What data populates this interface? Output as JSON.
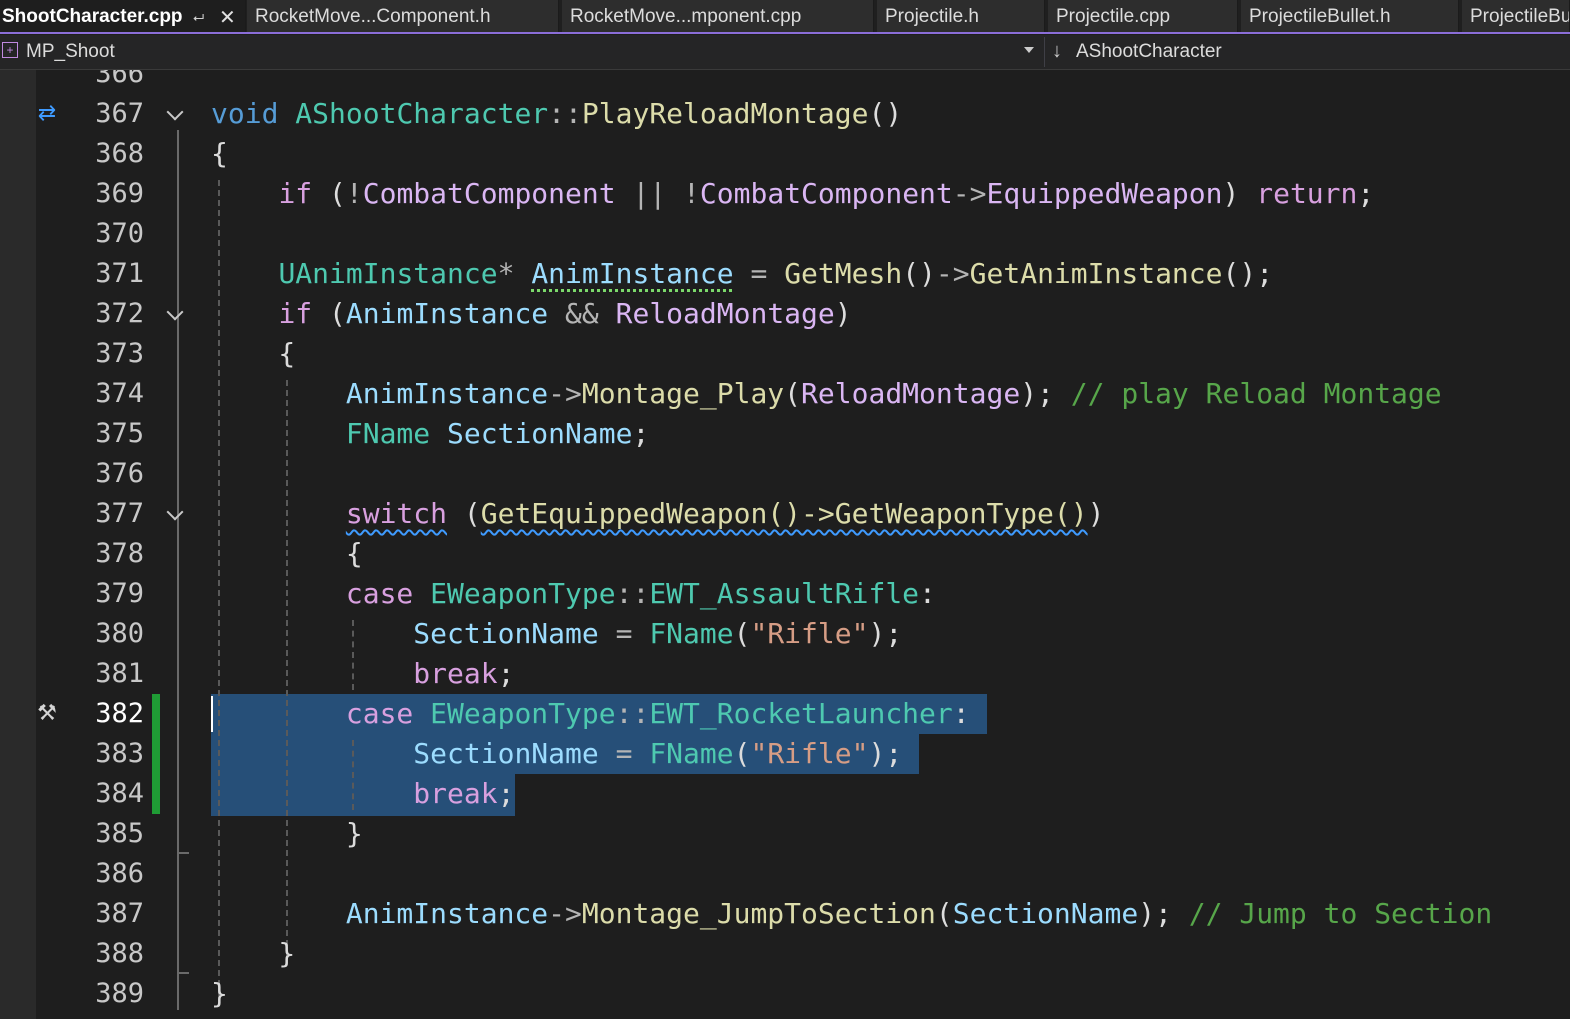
{
  "tabs": [
    {
      "label": "ShootCharacter.cpp",
      "active": true
    },
    {
      "label": "RocketMove...Component.h"
    },
    {
      "label": "RocketMove...mponent.cpp"
    },
    {
      "label": "Projectile.h"
    },
    {
      "label": "Projectile.cpp"
    },
    {
      "label": "ProjectileBullet.h"
    },
    {
      "label": "ProjectileBu"
    }
  ],
  "nav": {
    "project": "MP_Shoot",
    "scope": "AShootCharacter"
  },
  "editor": {
    "partial_line": "366",
    "lines": [
      {
        "n": "367",
        "tokens": [
          [
            "kw",
            "void"
          ],
          [
            "p",
            " "
          ],
          [
            "type",
            "AShootCharacter"
          ],
          [
            "op",
            "::"
          ],
          [
            "fn",
            "PlayReloadMontage"
          ],
          [
            "p",
            "()"
          ]
        ]
      },
      {
        "n": "368",
        "tokens": [
          [
            "p",
            "{"
          ]
        ]
      },
      {
        "n": "369",
        "tokens": [
          [
            "p",
            "    "
          ],
          [
            "ctl",
            "if"
          ],
          [
            "p",
            " ("
          ],
          [
            "op",
            "!"
          ],
          [
            "mem",
            "CombatComponent"
          ],
          [
            "p",
            " "
          ],
          [
            "op",
            "||"
          ],
          [
            "p",
            " "
          ],
          [
            "op",
            "!"
          ],
          [
            "mem",
            "CombatComponent"
          ],
          [
            "op",
            "->"
          ],
          [
            "mem",
            "EquippedWeapon"
          ],
          [
            "p",
            ") "
          ],
          [
            "ctl",
            "return"
          ],
          [
            "p",
            ";"
          ]
        ]
      },
      {
        "n": "370",
        "tokens": []
      },
      {
        "n": "371",
        "tokens": [
          [
            "p",
            "    "
          ],
          [
            "type",
            "UAnimInstance"
          ],
          [
            "op",
            "*"
          ],
          [
            "p",
            " "
          ],
          [
            "var_dots",
            "AnimInstance"
          ],
          [
            "p",
            " "
          ],
          [
            "op",
            "="
          ],
          [
            "p",
            " "
          ],
          [
            "fn",
            "GetMesh"
          ],
          [
            "p",
            "()"
          ],
          [
            "op",
            "->"
          ],
          [
            "fn",
            "GetAnimInstance"
          ],
          [
            "p",
            "();"
          ]
        ]
      },
      {
        "n": "372",
        "tokens": [
          [
            "p",
            "    "
          ],
          [
            "ctl",
            "if"
          ],
          [
            "p",
            " ("
          ],
          [
            "var",
            "AnimInstance"
          ],
          [
            "p",
            " "
          ],
          [
            "op",
            "&&"
          ],
          [
            "p",
            " "
          ],
          [
            "mem",
            "ReloadMontage"
          ],
          [
            "p",
            ")"
          ]
        ]
      },
      {
        "n": "373",
        "tokens": [
          [
            "p",
            "    {"
          ]
        ]
      },
      {
        "n": "374",
        "tokens": [
          [
            "p",
            "        "
          ],
          [
            "var",
            "AnimInstance"
          ],
          [
            "op",
            "->"
          ],
          [
            "fn",
            "Montage_Play"
          ],
          [
            "p",
            "("
          ],
          [
            "mem",
            "ReloadMontage"
          ],
          [
            "p",
            "); "
          ],
          [
            "com",
            "// play Reload Montage"
          ]
        ]
      },
      {
        "n": "375",
        "tokens": [
          [
            "p",
            "        "
          ],
          [
            "type",
            "FName"
          ],
          [
            "p",
            " "
          ],
          [
            "var",
            "SectionName"
          ],
          [
            "p",
            ";"
          ]
        ]
      },
      {
        "n": "376",
        "tokens": []
      },
      {
        "n": "377",
        "tokens": [
          [
            "p",
            "        "
          ],
          [
            "ctl_squig",
            "switch"
          ],
          [
            "p",
            " ("
          ],
          [
            "fn_squig",
            "GetEquippedWeapon()->GetWeaponType()"
          ],
          [
            "p",
            ")"
          ]
        ]
      },
      {
        "n": "378",
        "tokens": [
          [
            "p",
            "        {"
          ]
        ]
      },
      {
        "n": "379",
        "tokens": [
          [
            "p",
            "        "
          ],
          [
            "ctl",
            "case"
          ],
          [
            "p",
            " "
          ],
          [
            "type",
            "EWeaponType"
          ],
          [
            "op",
            "::"
          ],
          [
            "type",
            "EWT_AssaultRifle"
          ],
          [
            "p",
            ":"
          ]
        ]
      },
      {
        "n": "380",
        "tokens": [
          [
            "p",
            "            "
          ],
          [
            "var",
            "SectionName"
          ],
          [
            "p",
            " "
          ],
          [
            "op",
            "="
          ],
          [
            "p",
            " "
          ],
          [
            "type",
            "FName"
          ],
          [
            "p",
            "("
          ],
          [
            "str",
            "\"Rifle\""
          ],
          [
            "p",
            ");"
          ]
        ]
      },
      {
        "n": "381",
        "tokens": [
          [
            "p",
            "            "
          ],
          [
            "ctl",
            "break"
          ],
          [
            "p",
            ";"
          ]
        ]
      },
      {
        "n": "382",
        "tokens": [
          [
            "p",
            "        "
          ],
          [
            "ctl",
            "case"
          ],
          [
            "p",
            " "
          ],
          [
            "type",
            "EWeaponType"
          ],
          [
            "op",
            "::"
          ],
          [
            "type",
            "EWT_RocketLauncher"
          ],
          [
            "p",
            ":"
          ]
        ]
      },
      {
        "n": "383",
        "tokens": [
          [
            "p",
            "            "
          ],
          [
            "var",
            "SectionName"
          ],
          [
            "p",
            " "
          ],
          [
            "op",
            "="
          ],
          [
            "p",
            " "
          ],
          [
            "type",
            "FName"
          ],
          [
            "p",
            "("
          ],
          [
            "str",
            "\"Rifle\""
          ],
          [
            "p",
            ");"
          ]
        ]
      },
      {
        "n": "384",
        "tokens": [
          [
            "p",
            "            "
          ],
          [
            "ctl",
            "break"
          ],
          [
            "p",
            ";"
          ]
        ]
      },
      {
        "n": "385",
        "tokens": [
          [
            "p",
            "        }"
          ]
        ]
      },
      {
        "n": "386",
        "tokens": []
      },
      {
        "n": "387",
        "tokens": [
          [
            "p",
            "        "
          ],
          [
            "var",
            "AnimInstance"
          ],
          [
            "op",
            "->"
          ],
          [
            "fn",
            "Montage_JumpToSection"
          ],
          [
            "p",
            "("
          ],
          [
            "var",
            "SectionName"
          ],
          [
            "p",
            "); "
          ],
          [
            "com",
            "// Jump to Section"
          ]
        ]
      },
      {
        "n": "388",
        "tokens": [
          [
            "p",
            "    }"
          ]
        ]
      },
      {
        "n": "389",
        "tokens": [
          [
            "p",
            "}"
          ]
        ]
      }
    ]
  },
  "colors": {
    "accent": "#8b6ed8",
    "selection": "#264f78",
    "change_bar": "#1f9c35"
  },
  "icons": {
    "sync": "sync-arrows-icon",
    "hammer": "hammer-icon",
    "fold": "chevron-down-icon"
  }
}
